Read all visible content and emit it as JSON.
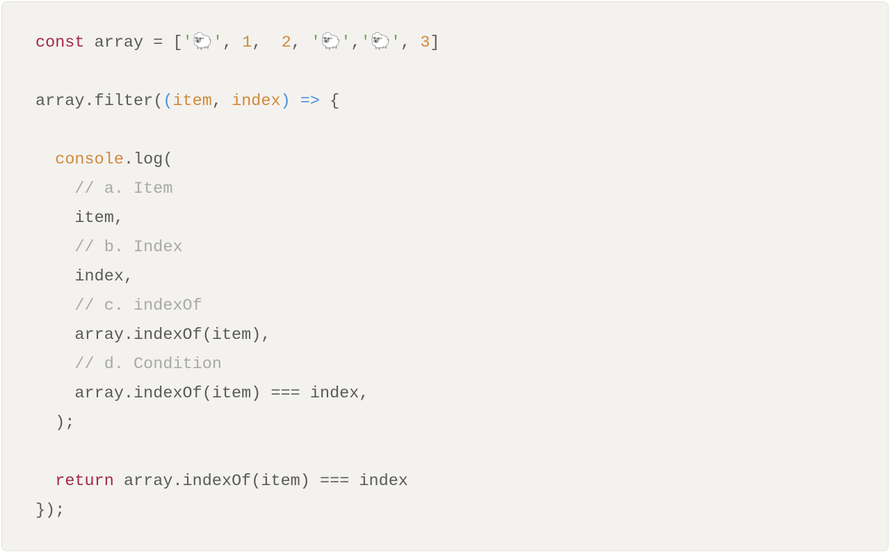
{
  "code": {
    "l1": {
      "kw_const": "const",
      "id_array": " array ",
      "eq": "= ",
      "lbracket": "[",
      "q1a": "'",
      "sheep1": "🐑",
      "q1b": "'",
      "comma1": ", ",
      "n1": "1",
      "comma2": ",  ",
      "n2": "2",
      "comma3": ", ",
      "q2a": "'",
      "sheep2": "🐑",
      "q2b": "'",
      "comma4": ",",
      "q3a": "'",
      "sheep3": "🐑",
      "q3b": "'",
      "comma5": ", ",
      "n3": "3",
      "rbracket": "]"
    },
    "l3": {
      "pre": "array.filter(",
      "lp": "(",
      "p1": "item",
      "pc": ", ",
      "p2": "index",
      "rp": ")",
      "arrow": " =>",
      "brace": " {"
    },
    "l5": {
      "indent": "  ",
      "console": "console",
      "dotlog": ".log("
    },
    "l6": {
      "indent": "    ",
      "c": "// a. Item"
    },
    "l7": {
      "indent": "    ",
      "t": "item,"
    },
    "l8": {
      "indent": "    ",
      "c": "// b. Index"
    },
    "l9": {
      "indent": "    ",
      "t": "index,"
    },
    "l10": {
      "indent": "    ",
      "c": "// c. indexOf"
    },
    "l11": {
      "indent": "    ",
      "t": "array.indexOf(item),"
    },
    "l12": {
      "indent": "    ",
      "c": "// d. Condition"
    },
    "l13": {
      "indent": "    ",
      "t": "array.indexOf(item) === index,"
    },
    "l14": {
      "indent": "  ",
      "t": ");"
    },
    "l16": {
      "indent": "  ",
      "kw": "return",
      "t": " array.indexOf(item) === index"
    },
    "l17": {
      "t": "});"
    }
  }
}
